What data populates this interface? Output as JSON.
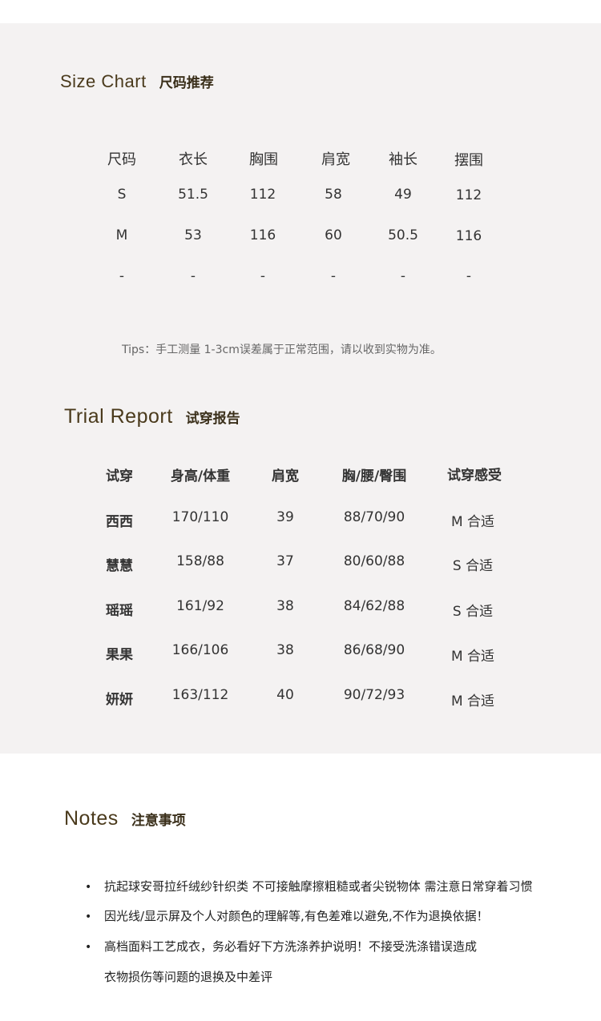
{
  "size_chart": {
    "title_en": "Size Chart",
    "title_cn": "尺码推荐",
    "headers": [
      "尺码",
      "衣长",
      "胸围",
      "肩宽",
      "袖长",
      "摆围"
    ],
    "rows": [
      [
        "S",
        "51.5",
        "112",
        "58",
        "49",
        "112"
      ],
      [
        "M",
        "53",
        "116",
        "60",
        "50.5",
        "116"
      ],
      [
        "-",
        "-",
        "-",
        "-",
        "-",
        "-"
      ]
    ],
    "tips": "Tips：手工测量 1-3cm误差属于正常范围，请以收到实物为准。"
  },
  "trial_report": {
    "title_en": "Trial Report",
    "title_cn": "试穿报告",
    "headers": [
      "试穿",
      "身高/体重",
      "肩宽",
      "胸/腰/臀围",
      "试穿感受"
    ],
    "rows": [
      [
        "西西",
        "170/110",
        "39",
        "88/70/90",
        "M 合适"
      ],
      [
        "慧慧",
        "158/88",
        "37",
        "80/60/88",
        "S 合适"
      ],
      [
        "瑶瑶",
        "161/92",
        "38",
        "84/62/88",
        "S 合适"
      ],
      [
        "果果",
        "166/106",
        "38",
        "86/68/90",
        "M 合适"
      ],
      [
        "妍妍",
        "163/112",
        "40",
        "90/72/93",
        "M 合适"
      ]
    ]
  },
  "notes": {
    "title_en": "Notes",
    "title_cn": "注意事项",
    "bullet": "•",
    "items": [
      "抗起球安哥拉纤绒纱针织类 不可接触摩擦粗糙或者尖锐物体 需注意日常穿着习惯",
      "因光线/显示屏及个人对颜色的理解等,有色差难以避免,不作为退换依据！",
      "高档面料工艺成衣，务必看好下方洗涤养护说明！不接受洗涤错误造成"
    ],
    "continuation": "衣物损伤等问题的退换及中差评"
  }
}
